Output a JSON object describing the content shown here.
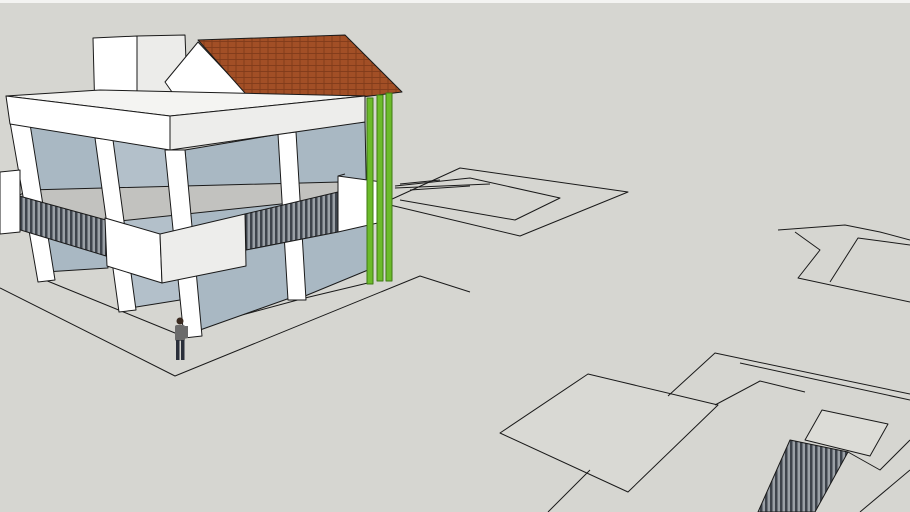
{
  "scene": {
    "colors": {
      "background": "#d6d6d1",
      "wall": "#ffffff",
      "wall_shade": "#e6e6e4",
      "glass": "#a9b8c3",
      "floor": "#c2c2bf",
      "roof": "#a24f26",
      "railing": "#4a5058",
      "pipes": "#6cbb2a",
      "edges": "#1a1a1a"
    },
    "icons": [
      "person-figure"
    ]
  }
}
